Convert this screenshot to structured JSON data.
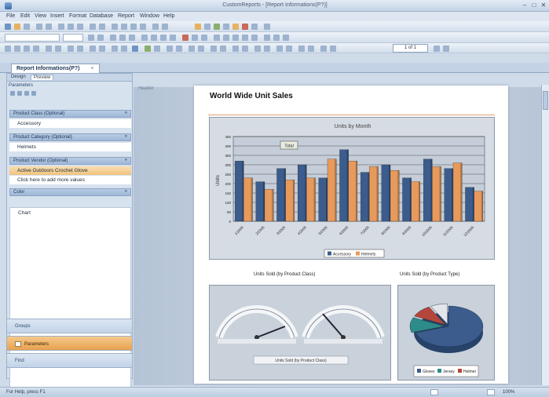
{
  "window": {
    "title": "CustomReports - [Report Informations(P?)]",
    "controls": {
      "minimize": "–",
      "maximize": "□",
      "close": "✕"
    }
  },
  "menu": [
    "File",
    "Edit",
    "View",
    "Insert",
    "Format",
    "Database",
    "Report",
    "Window",
    "Help"
  ],
  "document_tab": {
    "label": "Report Informations(P?)",
    "close": "×"
  },
  "toolbar": {
    "page_box": "1 of 1"
  },
  "panel": {
    "tabs": [
      "Design",
      "Preview"
    ],
    "header": "Parameters",
    "groups": [
      {
        "label": "Product Class (Optional)",
        "value": "Accessory",
        "selected": false
      },
      {
        "label": "Product Category (Optional)",
        "value": "Helmets",
        "selected": false
      },
      {
        "label": "Product Vendor (Optional)",
        "value": "Active Outdoors Crochet Glove",
        "selected": true
      },
      {
        "label": "",
        "value": "Click here to add more values",
        "selected": false
      },
      {
        "label": "Color",
        "value": "",
        "selected": false
      }
    ],
    "list_item": "Chart",
    "chevron": "»",
    "nav": [
      {
        "label": "Groups",
        "active": false
      },
      {
        "label": "Parameters",
        "active": true
      },
      {
        "label": "Find",
        "active": false
      }
    ]
  },
  "report": {
    "ruler_label": "Header",
    "title": "World Wide Unit Sales",
    "gauge_caption": "Units Sold (by Product Class)",
    "pie_caption": "Units Sold (by Product Type)",
    "gauge_legend": "Units Sold (by Product Class)"
  },
  "chart_data": {
    "type": "bar",
    "title": "Units by Month",
    "ylabel": "Units",
    "ylim": [
      0,
      450
    ],
    "yticks": [
      0,
      50,
      100,
      150,
      200,
      250,
      300,
      350,
      400,
      450
    ],
    "categories": [
      "1/2005",
      "2/2005",
      "3/2005",
      "4/2005",
      "5/2005",
      "6/2005",
      "7/2005",
      "8/2005",
      "9/2005",
      "10/2005",
      "11/2005",
      "12/2005"
    ],
    "series": [
      {
        "name": "Accessory",
        "color": "#3b5c8c",
        "values": [
          320,
          210,
          280,
          300,
          230,
          380,
          260,
          300,
          230,
          330,
          280,
          180
        ]
      },
      {
        "name": "Helmets",
        "color": "#e79a5c",
        "values": [
          230,
          170,
          220,
          230,
          330,
          320,
          290,
          270,
          210,
          290,
          310,
          160
        ]
      }
    ],
    "annotation": "Total",
    "legend": [
      "Accessory",
      "Helmets"
    ],
    "legend_position": "bottom",
    "grid": true
  },
  "pie": {
    "slices": [
      {
        "value": 70,
        "color": "#3b5c8c"
      },
      {
        "value": 12,
        "color": "#2e8c88"
      },
      {
        "value": 10,
        "color": "#b5463b"
      },
      {
        "value": 8,
        "color": "#e2e6ea"
      }
    ],
    "legend": [
      "Gloves",
      "Jersey",
      "Helmet"
    ]
  },
  "statusbar": {
    "text": "For Help, press F1",
    "zoom": "100%"
  }
}
